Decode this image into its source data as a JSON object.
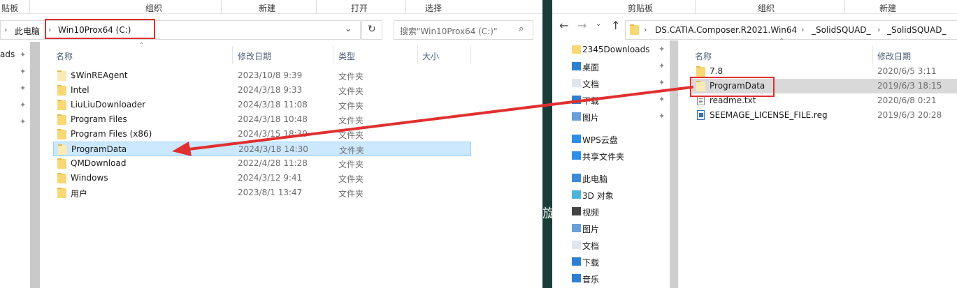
{
  "left": {
    "ribbon": {
      "g1": "贴板",
      "g2": "组织",
      "g3": "新建",
      "g4": "打开",
      "g5": "选择"
    },
    "address": {
      "root": "此电脑",
      "current": "Win10Prox64 (C:)"
    },
    "search_placeholder": "搜索\"Win10Prox64 (C:)\"",
    "nav_fragment": "ads",
    "columns": {
      "name": "名称",
      "date": "修改日期",
      "type": "类型",
      "size": "大小"
    },
    "rows": [
      {
        "name": "$WinREAgent",
        "date": "2023/10/8 9:39",
        "type": "文件夹",
        "icon": "folder-light-icon"
      },
      {
        "name": "Intel",
        "date": "2024/3/18 9:33",
        "type": "文件夹",
        "icon": "folder-icon"
      },
      {
        "name": "LiuLiuDownloader",
        "date": "2024/3/18 11:08",
        "type": "文件夹",
        "icon": "folder-icon"
      },
      {
        "name": "Program Files",
        "date": "2024/3/18 10:48",
        "type": "文件夹",
        "icon": "folder-icon"
      },
      {
        "name": "Program Files (x86)",
        "date": "2024/3/15 18:30",
        "type": "文件夹",
        "icon": "folder-icon"
      },
      {
        "name": "ProgramData",
        "date": "2024/3/18 14:30",
        "type": "文件夹",
        "icon": "folder-light-icon"
      },
      {
        "name": "QMDownload",
        "date": "2022/4/28 11:28",
        "type": "文件夹",
        "icon": "folder-icon"
      },
      {
        "name": "Windows",
        "date": "2024/3/12 9:41",
        "type": "文件夹",
        "icon": "folder-icon"
      },
      {
        "name": "用户",
        "date": "2023/8/1 13:47",
        "type": "文件夹",
        "icon": "folder-icon"
      }
    ],
    "selected_row": "ProgramData"
  },
  "right": {
    "ribbon": {
      "g1": "剪贴板",
      "g2": "组织",
      "g3": "新建"
    },
    "address": {
      "p1": "DS.CATIA.Composer.R2021.Win64",
      "p2": "_SolidSQUAD_",
      "p3": "_SolidSQUAD_"
    },
    "nav": [
      {
        "label": "2345Downloads",
        "icon": "folder-icon"
      },
      {
        "label": "桌面",
        "icon": "desktop-icon"
      },
      {
        "label": "文档",
        "icon": "document-icon"
      },
      {
        "label": "下载",
        "icon": "download-icon"
      },
      {
        "label": "图片",
        "icon": "picture-icon"
      },
      {
        "label": "WPS云盘",
        "icon": "cloud-icon"
      },
      {
        "label": "共享文件夹",
        "icon": "share-icon"
      },
      {
        "label": "此电脑",
        "icon": "pc-icon"
      },
      {
        "label": "3D 对象",
        "icon": "cube-icon"
      },
      {
        "label": "视频",
        "icon": "video-icon"
      },
      {
        "label": "图片",
        "icon": "picture-icon"
      },
      {
        "label": "文档",
        "icon": "document-icon"
      },
      {
        "label": "下载",
        "icon": "download-icon"
      },
      {
        "label": "音乐",
        "icon": "music-icon"
      }
    ],
    "columns": {
      "name": "名称",
      "date": "修改日期"
    },
    "rows": [
      {
        "name": "7.8",
        "date": "2020/6/5 3:11",
        "icon": "folder-icon"
      },
      {
        "name": "ProgramData",
        "date": "2019/6/3 18:15",
        "icon": "folder-light-icon"
      },
      {
        "name": "readme.txt",
        "date": "2020/6/8 0:21",
        "icon": "text-file-icon"
      },
      {
        "name": "SEEMAGE_LICENSE_FILE.reg",
        "date": "2019/6/3 20:28",
        "icon": "registry-file-icon"
      }
    ]
  },
  "gap_glyph": "旋",
  "colors": {
    "annotation_red": "#e0302f",
    "selection": "#cce8ff",
    "folder": "#f8d775"
  }
}
